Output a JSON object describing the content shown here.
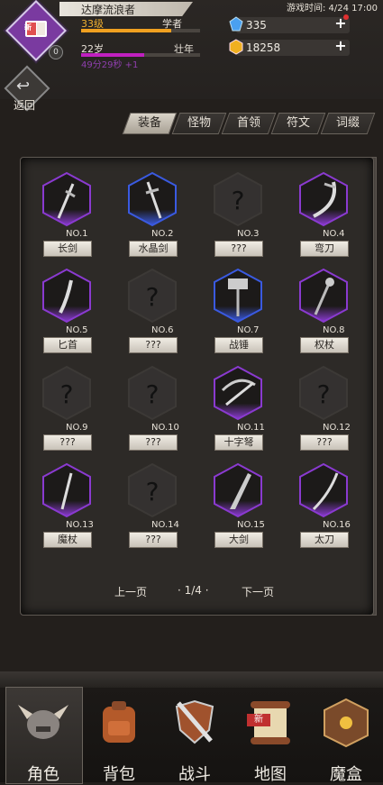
{
  "header": {
    "player_name": "达摩流浪者",
    "level": "33级",
    "class": "学者",
    "age": "22岁",
    "age_stage": "壮年",
    "time_left": "49分29秒 +1",
    "avatar_badge": "0",
    "avatar_new": "新",
    "game_time": "游戏时间: 4/24 17:00",
    "gems": "335",
    "gold": "18258"
  },
  "back": {
    "label": "返回"
  },
  "tabs": [
    {
      "label": "装备",
      "active": true
    },
    {
      "label": "怪物",
      "active": false
    },
    {
      "label": "首领",
      "active": false
    },
    {
      "label": "符文",
      "active": false
    },
    {
      "label": "词缀",
      "active": false
    }
  ],
  "items": [
    {
      "no": "NO.1",
      "label": "长剑",
      "known": true,
      "rarity": "purple",
      "icon": "long-sword-icon"
    },
    {
      "no": "NO.2",
      "label": "水晶剑",
      "known": true,
      "rarity": "blue",
      "icon": "crystal-sword-icon"
    },
    {
      "no": "NO.3",
      "label": "???",
      "known": false
    },
    {
      "no": "NO.4",
      "label": "弯刀",
      "known": true,
      "rarity": "purple",
      "icon": "scimitar-icon"
    },
    {
      "no": "NO.5",
      "label": "匕首",
      "known": true,
      "rarity": "purple",
      "icon": "dagger-icon"
    },
    {
      "no": "NO.6",
      "label": "???",
      "known": false
    },
    {
      "no": "NO.7",
      "label": "战锤",
      "known": true,
      "rarity": "blue",
      "icon": "war-hammer-icon"
    },
    {
      "no": "NO.8",
      "label": "权杖",
      "known": true,
      "rarity": "purple",
      "icon": "scepter-icon"
    },
    {
      "no": "NO.9",
      "label": "???",
      "known": false
    },
    {
      "no": "NO.10",
      "label": "???",
      "known": false
    },
    {
      "no": "NO.11",
      "label": "十字弩",
      "known": true,
      "rarity": "purple",
      "icon": "crossbow-icon"
    },
    {
      "no": "NO.12",
      "label": "???",
      "known": false
    },
    {
      "no": "NO.13",
      "label": "魔杖",
      "known": true,
      "rarity": "purple",
      "icon": "wand-icon"
    },
    {
      "no": "NO.14",
      "label": "???",
      "known": false
    },
    {
      "no": "NO.15",
      "label": "大剑",
      "known": true,
      "rarity": "purple",
      "icon": "great-sword-icon"
    },
    {
      "no": "NO.16",
      "label": "太刀",
      "known": true,
      "rarity": "purple",
      "icon": "katana-icon"
    }
  ],
  "pagination": {
    "prev": "上一页",
    "page": "· 1/4 ·",
    "next": "下一页"
  },
  "nav": [
    {
      "label": "角色",
      "icon": "helmet-icon",
      "active": true
    },
    {
      "label": "背包",
      "icon": "backpack-icon",
      "active": false
    },
    {
      "label": "战斗",
      "icon": "sword-shield-icon",
      "active": false
    },
    {
      "label": "地图",
      "icon": "scroll-map-icon",
      "active": false,
      "badge": "新"
    },
    {
      "label": "魔盒",
      "icon": "magic-box-icon",
      "active": false
    }
  ],
  "colors": {
    "purple": "#8a3ad0",
    "blue": "#3a5ae0",
    "gold": "#f0a020",
    "age": "#c020c0"
  }
}
